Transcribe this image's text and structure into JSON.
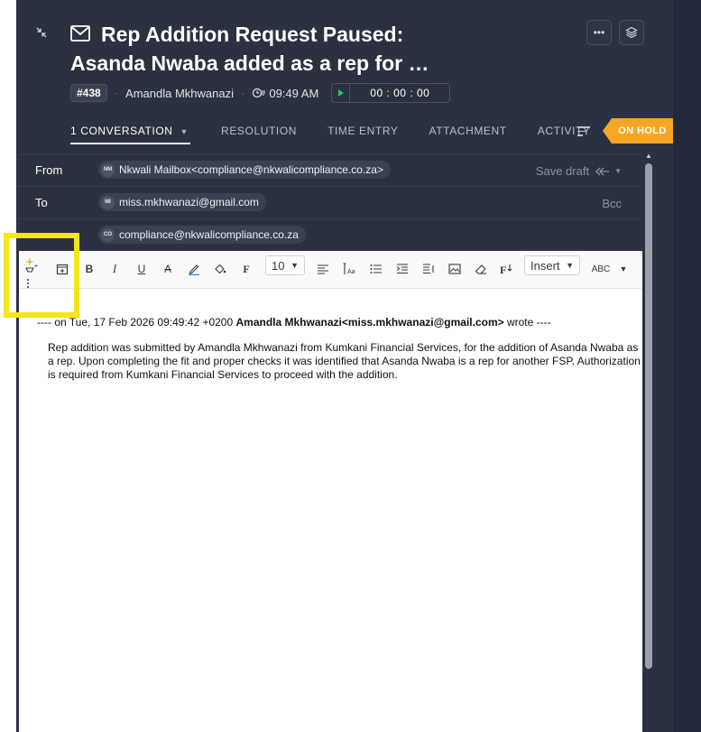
{
  "ticket": {
    "title": "Rep Addition Request Paused:\nAsanda Nwaba added as a rep for …",
    "id": "#438",
    "agent": "Amandla Mkhwanazi",
    "time": "09:49 AM",
    "timer": "00 : 00 : 00",
    "status": "ON HOLD"
  },
  "header_buttons": {
    "more_label": "•••"
  },
  "tabs": [
    {
      "label": "1 CONVERSATION"
    },
    {
      "label": "RESOLUTION"
    },
    {
      "label": "TIME ENTRY"
    },
    {
      "label": "ATTACHMENT"
    },
    {
      "label": "ACTIVITY"
    }
  ],
  "compose": {
    "from_label": "From",
    "from_initials": "NM",
    "from_value": "Nkwali Mailbox<compliance@nkwalicompliance.co.za>",
    "save_draft": "Save draft",
    "to_label": "To",
    "to_initials": "MI",
    "to_value": "miss.mkhwanazi@gmail.com",
    "bcc": "Bcc",
    "cc_initials": "CO",
    "cc_value": "compliance@nkwalicompliance.co.za"
  },
  "toolbar": {
    "font_size": "10",
    "insert_label": "Insert",
    "spell_label": "ABC"
  },
  "body": {
    "quote_prefix": "---- on Tue, 17 Feb 2026 09:49:42 +0200 ",
    "quote_sender": "Amandla Mkhwanazi<miss.mkhwanazi@gmail.com>",
    "quote_suffix": " wrote ----",
    "message": "Rep addition was submitted by Amandla Mkhwanazi from Kumkani Financial Services, for the addition of Asanda Nwaba as a rep. Upon completing the fit and proper checks it was identified that Asanda Nwaba is a rep for another FSP. Authorization is required from Kumkani Financial Services to proceed with the addition."
  },
  "colors": {
    "panel_bg": "#2b3140",
    "status_hold": "#f5a623",
    "highlight": "#f5e616"
  }
}
